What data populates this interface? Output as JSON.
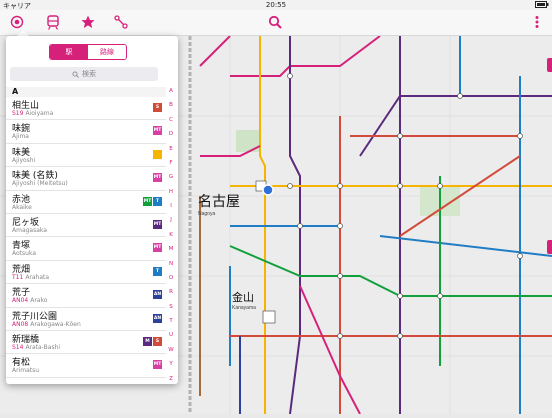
{
  "status": {
    "carrier": "キャリア",
    "time": "20:55",
    "battery": ""
  },
  "toolbar": {
    "icons": [
      "target-icon",
      "train-icon",
      "star-icon",
      "route-icon",
      "search-icon",
      "more-icon"
    ],
    "accent": "#d6217b"
  },
  "panel": {
    "segments": [
      "駅",
      "路線"
    ],
    "search_placeholder": "検索",
    "section": "A",
    "stations": [
      {
        "name": "相生山",
        "code": "S19",
        "romaji": "Aioiyama",
        "lines": [
          {
            "t": "S",
            "c": "#d24b3a"
          }
        ]
      },
      {
        "name": "味鋺",
        "code": "",
        "romaji": "Ajima",
        "lines": [
          {
            "t": "MT",
            "c": "#d63fa3"
          }
        ]
      },
      {
        "name": "味美",
        "code": "",
        "romaji": "Ajiyoshi",
        "lines": [
          {
            "t": "",
            "c": "#f4b400"
          }
        ]
      },
      {
        "name": "味美 (名鉄)",
        "code": "",
        "romaji": "Ajiyoshi (Meitetsu)",
        "lines": [
          {
            "t": "MT",
            "c": "#d63fa3"
          }
        ]
      },
      {
        "name": "赤池",
        "code": "",
        "romaji": "Akaike",
        "lines": [
          {
            "t": "MT",
            "c": "#12a03c"
          },
          {
            "t": "T",
            "c": "#1f7dc4"
          }
        ]
      },
      {
        "name": "尼ヶ坂",
        "code": "",
        "romaji": "Amagasaka",
        "lines": [
          {
            "t": "MT",
            "c": "#5a2a7e"
          }
        ]
      },
      {
        "name": "青塚",
        "code": "",
        "romaji": "Aotsuka",
        "lines": [
          {
            "t": "MT",
            "c": "#d63fa3"
          }
        ]
      },
      {
        "name": "荒畑",
        "code": "T11",
        "romaji": "Arahata",
        "lines": [
          {
            "t": "T",
            "c": "#1f7dc4"
          }
        ]
      },
      {
        "name": "荒子",
        "code": "AN04",
        "romaji": "Arako",
        "lines": [
          {
            "t": "AN",
            "c": "#2f3f9c"
          }
        ]
      },
      {
        "name": "荒子川公園",
        "code": "AN08",
        "romaji": "Arakogawa-Kōen",
        "lines": [
          {
            "t": "AN",
            "c": "#2f3f9c"
          }
        ]
      },
      {
        "name": "新瑞橋",
        "code": "S14",
        "romaji": "Arata-Bashi",
        "lines": [
          {
            "t": "M",
            "c": "#5a2a7e"
          },
          {
            "t": "S",
            "c": "#d24b3a"
          }
        ]
      },
      {
        "name": "有松",
        "code": "",
        "romaji": "Arimatsu",
        "lines": [
          {
            "t": "MT",
            "c": "#d63fa3"
          }
        ]
      }
    ],
    "index": [
      "A",
      "B",
      "C",
      "D",
      "E",
      "F",
      "G",
      "H",
      "I",
      "J",
      "K",
      "M",
      "N",
      "O",
      "R",
      "S",
      "T",
      "U",
      "W",
      "Y",
      "Z"
    ]
  },
  "map": {
    "labels": {
      "nagoya": "名古屋",
      "nagoya_romaji": "Nagoya",
      "kanayama": "金山",
      "kanayama_romaji": "Kanayama"
    }
  }
}
